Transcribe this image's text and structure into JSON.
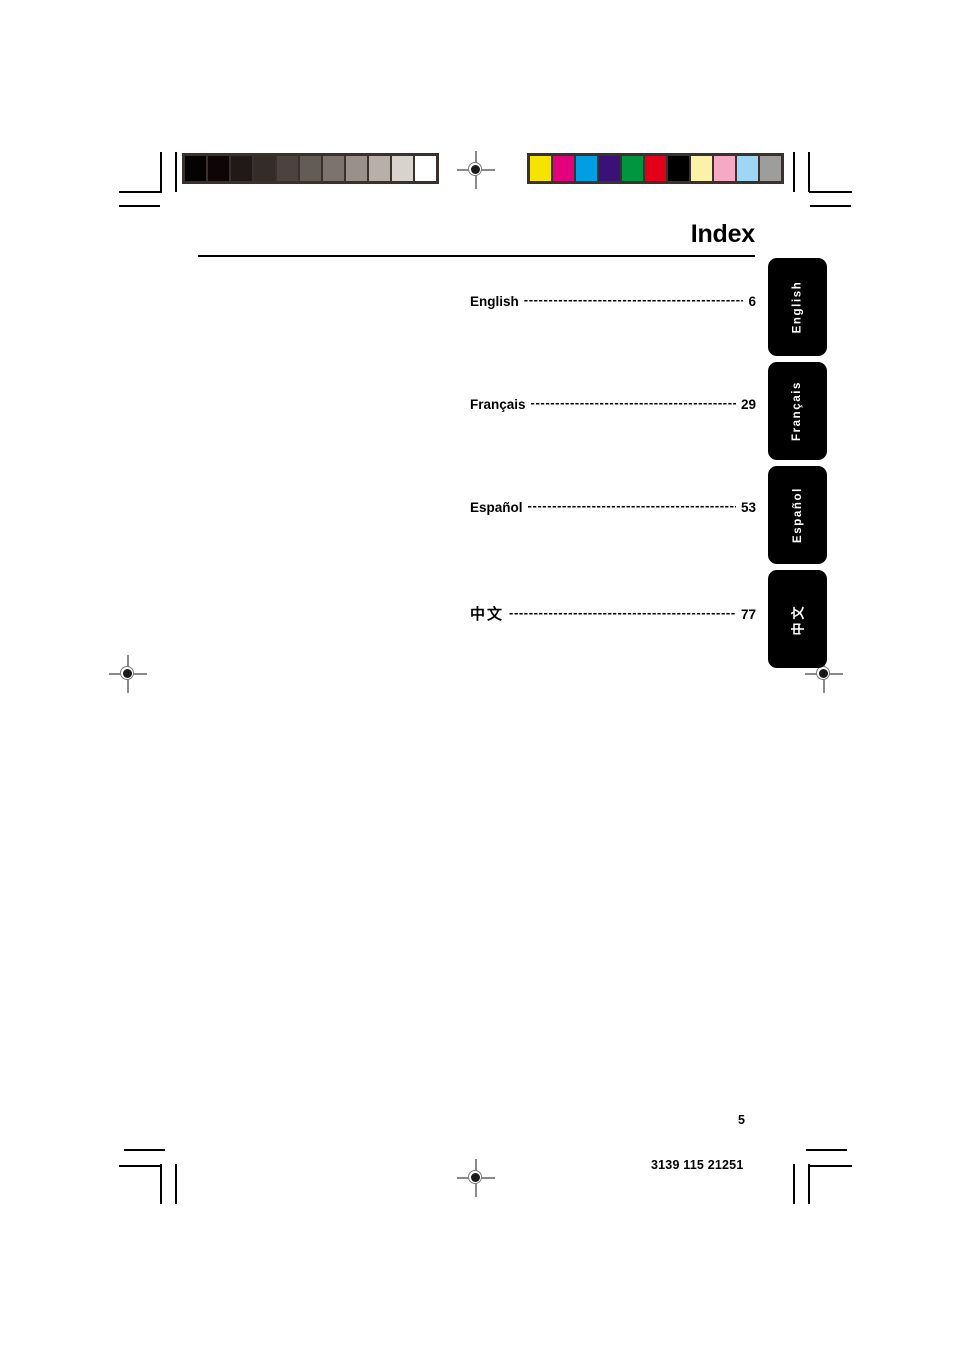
{
  "document": {
    "title": "Index",
    "folio": "5",
    "part_number": "3139 115 21251"
  },
  "index": {
    "entries": [
      {
        "language": "English",
        "leader": "----------------------------------------------",
        "page": "6",
        "script": "latin"
      },
      {
        "language": "Français",
        "leader": "-------------------------------------------",
        "page": "29",
        "script": "latin"
      },
      {
        "language": "Español",
        "leader": "--------------------------------------------",
        "page": "53",
        "script": "latin"
      },
      {
        "language": "中文",
        "leader": "----------------------------------------------",
        "page": "77",
        "script": "cjk"
      }
    ]
  },
  "side_tabs": [
    {
      "label": "English",
      "script": "latin",
      "background": "#000000",
      "text_color": "#ffffff"
    },
    {
      "label": "Français",
      "script": "latin",
      "background": "#000000",
      "text_color": "#ffffff"
    },
    {
      "label": "Español",
      "script": "latin",
      "background": "#000000",
      "text_color": "#ffffff"
    },
    {
      "label": "中文",
      "script": "cjk",
      "background": "#000000",
      "text_color": "#ffffff"
    }
  ],
  "print_calibration": {
    "grayscale_strip": {
      "name": "grayscale-step-wedge",
      "border": "#3a312e",
      "patches": [
        "#050203",
        "#0d0506",
        "#1f1a18",
        "#332c29",
        "#4b4340",
        "#635b56",
        "#7d736e",
        "#9a908b",
        "#b8afa9",
        "#d9d3cd",
        "#ffffff"
      ]
    },
    "color_strip": {
      "name": "process-color-bar",
      "border": "#3a312e",
      "patches": [
        "#f5e400",
        "#e2007d",
        "#009fe3",
        "#3b1178",
        "#009640",
        "#e3001b",
        "#000000",
        "#faf2a8",
        "#f5a9c4",
        "#9ed6f5",
        "#9d9d9c"
      ]
    }
  },
  "registration_marks": {
    "name": "registration-target",
    "count": 4
  }
}
